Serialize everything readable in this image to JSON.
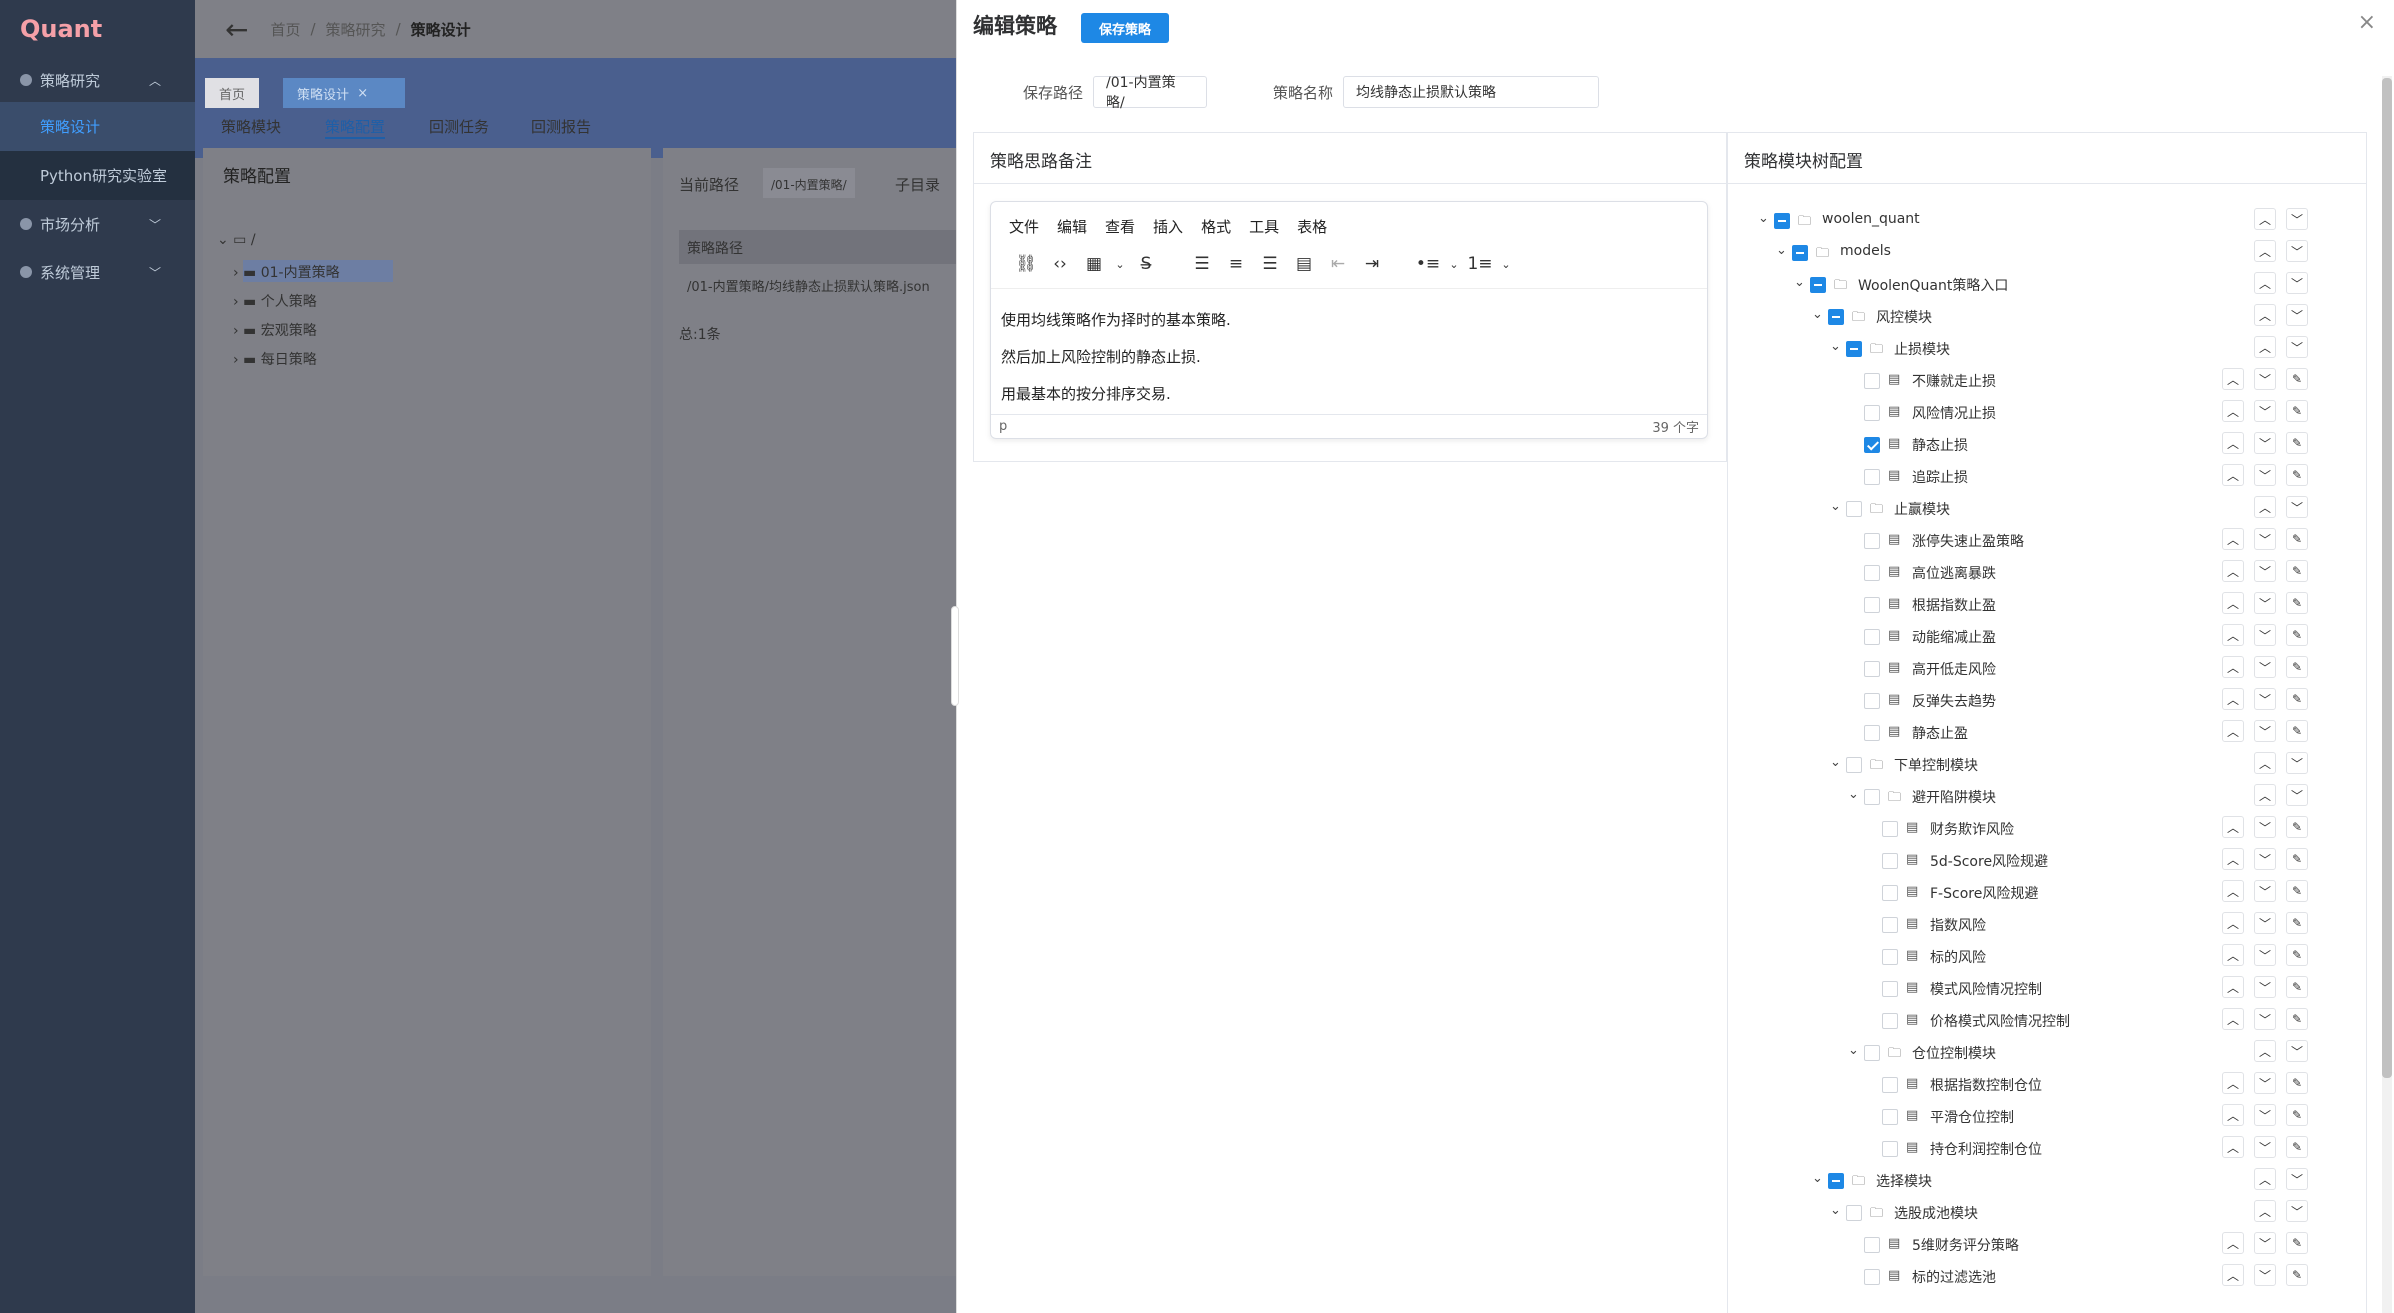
{
  "app": {
    "logo": "Quant"
  },
  "sidebar": {
    "groups": [
      {
        "label": "策略研究",
        "expanded": true,
        "items": [
          {
            "label": "策略设计",
            "active": true
          },
          {
            "label": "Python研究实验室",
            "active": false
          }
        ]
      },
      {
        "label": "市场分析",
        "expanded": false
      },
      {
        "label": "系统管理",
        "expanded": false
      }
    ]
  },
  "topbar": {
    "crumbs": [
      "首页",
      "策略研究",
      "策略设计"
    ]
  },
  "tags": [
    {
      "label": "首页"
    },
    {
      "label": "策略设计"
    }
  ],
  "subtabs": [
    "策略模块",
    "策略配置",
    "回测任务",
    "回测报告"
  ],
  "config_panel": {
    "title": "策略配置",
    "root": "/",
    "folders": [
      "01-内置策略",
      "个人策略",
      "宏观策略",
      "每日策略"
    ]
  },
  "path_panel": {
    "current_path_label": "当前路径",
    "current_path_value": "/01-内置策略/",
    "subdir_label": "子目录",
    "col_header": "策略路径",
    "row": "/01-内置策略/均线静态止损默认策略.json",
    "total": "总:1条"
  },
  "drawer": {
    "title": "编辑策略",
    "save_label": "保存策略",
    "close_icon": "×",
    "save_path_label": "保存路径",
    "save_path_value": "/01-内置策略/",
    "name_label": "策略名称",
    "name_value": "均线静态止损默认策略",
    "notes_title": "策略思路备注",
    "tree_title": "策略模块树配置"
  },
  "editor": {
    "menu": [
      "文件",
      "编辑",
      "查看",
      "插入",
      "格式",
      "工具",
      "表格"
    ],
    "lines": [
      "使用均线策略作为择时的基本策略.",
      "然后加上风险控制的静态止损.",
      "用最基本的按分排序交易."
    ],
    "status_left": "p",
    "status_right": "39 个字"
  },
  "tree": [
    {
      "label": "woolen_quant",
      "level": 0,
      "state": "ind",
      "type": "folder",
      "toggle": true,
      "edit": false
    },
    {
      "label": "models",
      "level": 1,
      "state": "ind",
      "type": "folder",
      "toggle": true,
      "edit": false
    },
    {
      "label": "WoolenQuant策略入口",
      "level": 2,
      "state": "ind",
      "type": "folder",
      "toggle": true,
      "edit": false
    },
    {
      "label": "风控模块",
      "level": 3,
      "state": "ind",
      "type": "folder",
      "toggle": true,
      "edit": false
    },
    {
      "label": "止损模块",
      "level": 4,
      "state": "ind",
      "type": "folder",
      "toggle": true,
      "edit": false
    },
    {
      "label": "不赚就走止损",
      "level": 5,
      "state": "none",
      "type": "file",
      "toggle": false,
      "edit": true
    },
    {
      "label": "风险情况止损",
      "level": 5,
      "state": "none",
      "type": "file",
      "toggle": false,
      "edit": true
    },
    {
      "label": "静态止损",
      "level": 5,
      "state": "chk",
      "type": "file",
      "toggle": false,
      "edit": true
    },
    {
      "label": "追踪止损",
      "level": 5,
      "state": "none",
      "type": "file",
      "toggle": false,
      "edit": true
    },
    {
      "label": "止赢模块",
      "level": 4,
      "state": "none",
      "type": "folder",
      "toggle": true,
      "edit": false
    },
    {
      "label": "涨停失速止盈策略",
      "level": 5,
      "state": "none",
      "type": "file",
      "toggle": false,
      "edit": true
    },
    {
      "label": "高位逃离暴跌",
      "level": 5,
      "state": "none",
      "type": "file",
      "toggle": false,
      "edit": true
    },
    {
      "label": "根据指数止盈",
      "level": 5,
      "state": "none",
      "type": "file",
      "toggle": false,
      "edit": true
    },
    {
      "label": "动能缩减止盈",
      "level": 5,
      "state": "none",
      "type": "file",
      "toggle": false,
      "edit": true
    },
    {
      "label": "高开低走风险",
      "level": 5,
      "state": "none",
      "type": "file",
      "toggle": false,
      "edit": true
    },
    {
      "label": "反弹失去趋势",
      "level": 5,
      "state": "none",
      "type": "file",
      "toggle": false,
      "edit": true
    },
    {
      "label": "静态止盈",
      "level": 5,
      "state": "none",
      "type": "file",
      "toggle": false,
      "edit": true
    },
    {
      "label": "下单控制模块",
      "level": 4,
      "state": "none",
      "type": "folder",
      "toggle": true,
      "edit": false
    },
    {
      "label": "避开陷阱模块",
      "level": 5,
      "state": "none",
      "type": "folder",
      "toggle": true,
      "edit": false
    },
    {
      "label": "财务欺诈风险",
      "level": 6,
      "state": "none",
      "type": "file",
      "toggle": false,
      "edit": true
    },
    {
      "label": "5d-Score风险规避",
      "level": 6,
      "state": "none",
      "type": "file",
      "toggle": false,
      "edit": true
    },
    {
      "label": "F-Score风险规避",
      "level": 6,
      "state": "none",
      "type": "file",
      "toggle": false,
      "edit": true
    },
    {
      "label": "指数风险",
      "level": 6,
      "state": "none",
      "type": "file",
      "toggle": false,
      "edit": true
    },
    {
      "label": "标的风险",
      "level": 6,
      "state": "none",
      "type": "file",
      "toggle": false,
      "edit": true
    },
    {
      "label": "模式风险情况控制",
      "level": 6,
      "state": "none",
      "type": "file",
      "toggle": false,
      "edit": true
    },
    {
      "label": "价格模式风险情况控制",
      "level": 6,
      "state": "none",
      "type": "file",
      "toggle": false,
      "edit": true
    },
    {
      "label": "仓位控制模块",
      "level": 5,
      "state": "none",
      "type": "folder",
      "toggle": true,
      "edit": false
    },
    {
      "label": "根据指数控制仓位",
      "level": 6,
      "state": "none",
      "type": "file",
      "toggle": false,
      "edit": true
    },
    {
      "label": "平滑仓位控制",
      "level": 6,
      "state": "none",
      "type": "file",
      "toggle": false,
      "edit": true
    },
    {
      "label": "持仓利润控制仓位",
      "level": 6,
      "state": "none",
      "type": "file",
      "toggle": false,
      "edit": true
    },
    {
      "label": "选择模块",
      "level": 3,
      "state": "ind",
      "type": "folder",
      "toggle": true,
      "edit": false
    },
    {
      "label": "选股成池模块",
      "level": 4,
      "state": "none",
      "type": "folder",
      "toggle": true,
      "edit": false
    },
    {
      "label": "5维财务评分策略",
      "level": 5,
      "state": "none",
      "type": "file",
      "toggle": false,
      "edit": true
    },
    {
      "label": "标的过滤选池",
      "level": 5,
      "state": "none",
      "type": "file",
      "toggle": false,
      "edit": true
    }
  ]
}
